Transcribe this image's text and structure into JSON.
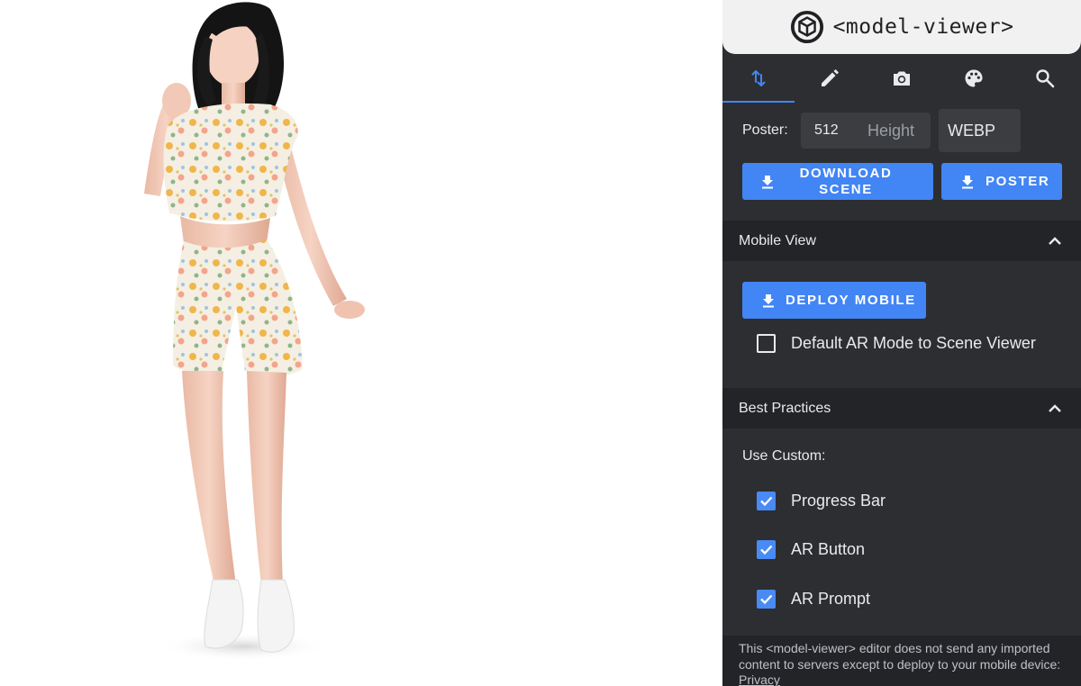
{
  "app": {
    "brand_text": "<model-viewer>"
  },
  "tabs": [
    {
      "name": "edit-tab",
      "icon": "swap-vert-icon",
      "active": true
    },
    {
      "name": "pencil-tab",
      "icon": "pencil-icon",
      "active": false
    },
    {
      "name": "camera-tab",
      "icon": "camera-icon",
      "active": false
    },
    {
      "name": "palette-tab",
      "icon": "palette-icon",
      "active": false
    },
    {
      "name": "search-tab",
      "icon": "search-icon",
      "active": false
    }
  ],
  "export": {
    "poster_label": "Poster:",
    "poster_width_value": "512",
    "poster_height_placeholder": "Height",
    "poster_format": "WEBP",
    "download_scene_label": "DOWNLOAD SCENE",
    "poster_button_label": "POSTER"
  },
  "mobile_view": {
    "title": "Mobile View",
    "deploy_label": "DEPLOY MOBILE",
    "ar_mode_label": "Default AR Mode to Scene Viewer",
    "ar_mode_checked": false
  },
  "best_practices": {
    "title": "Best Practices",
    "use_custom_label": "Use Custom:",
    "options": [
      {
        "label": "Progress Bar",
        "checked": true
      },
      {
        "label": "AR Button",
        "checked": true
      },
      {
        "label": "AR Prompt",
        "checked": true
      }
    ]
  },
  "footer": {
    "text": "This <model-viewer> editor does not send any imported content to servers except to deploy to your mobile device: ",
    "privacy_link": "Privacy"
  },
  "colors": {
    "accent": "#4285f4",
    "panel_bg": "#2d2e31",
    "section_bg": "#232428",
    "brand_bg": "#f1f1f1"
  }
}
